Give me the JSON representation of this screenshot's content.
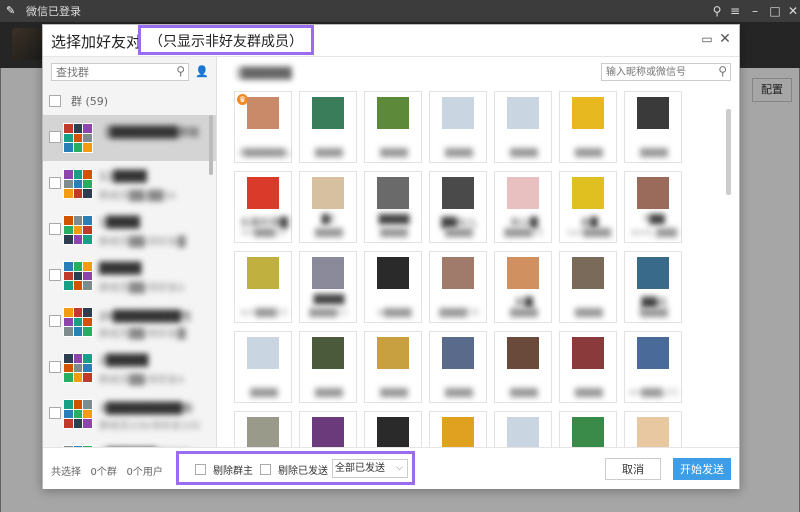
{
  "app": {
    "title": "微信已登录",
    "config_label": "配置"
  },
  "dialog": {
    "title": "选择加好友对象",
    "subtitle": "（只显示非好友群成员）"
  },
  "left_panel": {
    "search_placeholder": "查找群",
    "group_header_label": "群",
    "group_count": "(59)",
    "groups": [
      {
        "name": "【████████群联",
        "sub": ""
      },
      {
        "name": "11████",
        "sub": "群成员██/██30"
      },
      {
        "name": "1████",
        "sub": "群成员██/非好友█"
      },
      {
        "name": "█████",
        "sub": "群成员██/非好友0"
      },
      {
        "name": "20████████性",
        "sub": "群成员██/非好友█"
      },
      {
        "name": "2█████",
        "sub": "群成员██/非好友4"
      },
      {
        "name": "3█████████新",
        "sub": "群成员339/非好友335"
      },
      {
        "name": "3██████号新闻",
        "sub": "群成员██/非好友320"
      }
    ]
  },
  "right_panel": {
    "group_title": "【██████",
    "search_placeholder": "输入昵称或微信号",
    "members": [
      {
        "name": "",
        "id": "2██████g",
        "owner": true,
        "color": "#c98a6a"
      },
      {
        "name": "",
        "id": "████",
        "owner": false,
        "color": "#3a7d5a"
      },
      {
        "name": "",
        "id": "████",
        "owner": false,
        "color": "#5c8a3a"
      },
      {
        "name": "",
        "id": "████",
        "owner": false,
        "color": "#c9d6e2"
      },
      {
        "name": "",
        "id": "████",
        "owner": false,
        "color": "#c9d6e2"
      },
      {
        "name": "",
        "id": "████",
        "owner": false,
        "color": "#e8b820"
      },
      {
        "name": "",
        "id": "████",
        "owner": false,
        "color": "#3a3a3a"
      },
      {
        "name": "长嘉轩德█",
        "id": "wx███22",
        "owner": false,
        "color": "#d93a2a"
      },
      {
        "name": "█C",
        "id": "████",
        "owner": false,
        "color": "#d6c0a0"
      },
      {
        "name": "████",
        "id": "████",
        "owner": false,
        "color": "#6a6a6a"
      },
      {
        "name": "██伙儿",
        "id": "████",
        "owner": false,
        "color": "#4a4a4a"
      },
      {
        "name": "张公█",
        "id": "████22",
        "owner": false,
        "color": "#e8c0c0"
      },
      {
        "name": "舍█",
        "id": "sun████",
        "owner": false,
        "color": "#e0c020"
      },
      {
        "name": "Y██",
        "id": "wxid_███",
        "owner": false,
        "color": "#9a6a5a"
      },
      {
        "name": "",
        "id": "wxi███22",
        "owner": false,
        "color": "#c0b040"
      },
      {
        "name": "████",
        "id": "████21",
        "owner": false,
        "color": "#8a8a9a"
      },
      {
        "name": "",
        "id": "w████",
        "owner": false,
        "color": "#2a2a2a"
      },
      {
        "name": "",
        "id": "████18",
        "owner": false,
        "color": "#a07a6a"
      },
      {
        "name": "新█",
        "id": "████",
        "owner": false,
        "color": "#d09060"
      },
      {
        "name": "",
        "id": "████",
        "owner": false,
        "color": "#7a6a5a"
      },
      {
        "name": "██田",
        "id": "████",
        "owner": false,
        "color": "#3a6a8a"
      },
      {
        "name": "",
        "id": "████",
        "owner": false,
        "color": "#c9d6e2"
      },
      {
        "name": "",
        "id": "████",
        "owner": false,
        "color": "#4a5a3a"
      },
      {
        "name": "",
        "id": "████",
        "owner": false,
        "color": "#c8a040"
      },
      {
        "name": "",
        "id": "████",
        "owner": false,
        "color": "#5a6a8a"
      },
      {
        "name": "",
        "id": "████",
        "owner": false,
        "color": "#6a4a3a"
      },
      {
        "name": "",
        "id": "████",
        "owner": false,
        "color": "#8a3a3a"
      },
      {
        "name": "",
        "id": "wx███y21",
        "owner": false,
        "color": "#4a6a9a"
      },
      {
        "name": "",
        "id": "",
        "owner": false,
        "color": "#9a9a8a"
      },
      {
        "name": "",
        "id": "",
        "owner": false,
        "color": "#6a3a7a"
      },
      {
        "name": "",
        "id": "",
        "owner": false,
        "color": "#2a2a2a"
      },
      {
        "name": "",
        "id": "",
        "owner": false,
        "color": "#e0a020"
      },
      {
        "name": "",
        "id": "",
        "owner": false,
        "color": "#c9d6e2"
      },
      {
        "name": "",
        "id": "",
        "owner": false,
        "color": "#3a8a4a"
      },
      {
        "name": "",
        "id": "",
        "owner": false,
        "color": "#e8c8a0"
      }
    ]
  },
  "footer": {
    "selected_label": "共选择",
    "groups_count": "0个群",
    "users_count": "0个用户",
    "exclude_owner_label": "剔除群主",
    "exclude_sent_label": "剔除已发送",
    "send_filter_value": "全部已发送",
    "cancel_label": "取消",
    "start_label": "开始发送"
  }
}
